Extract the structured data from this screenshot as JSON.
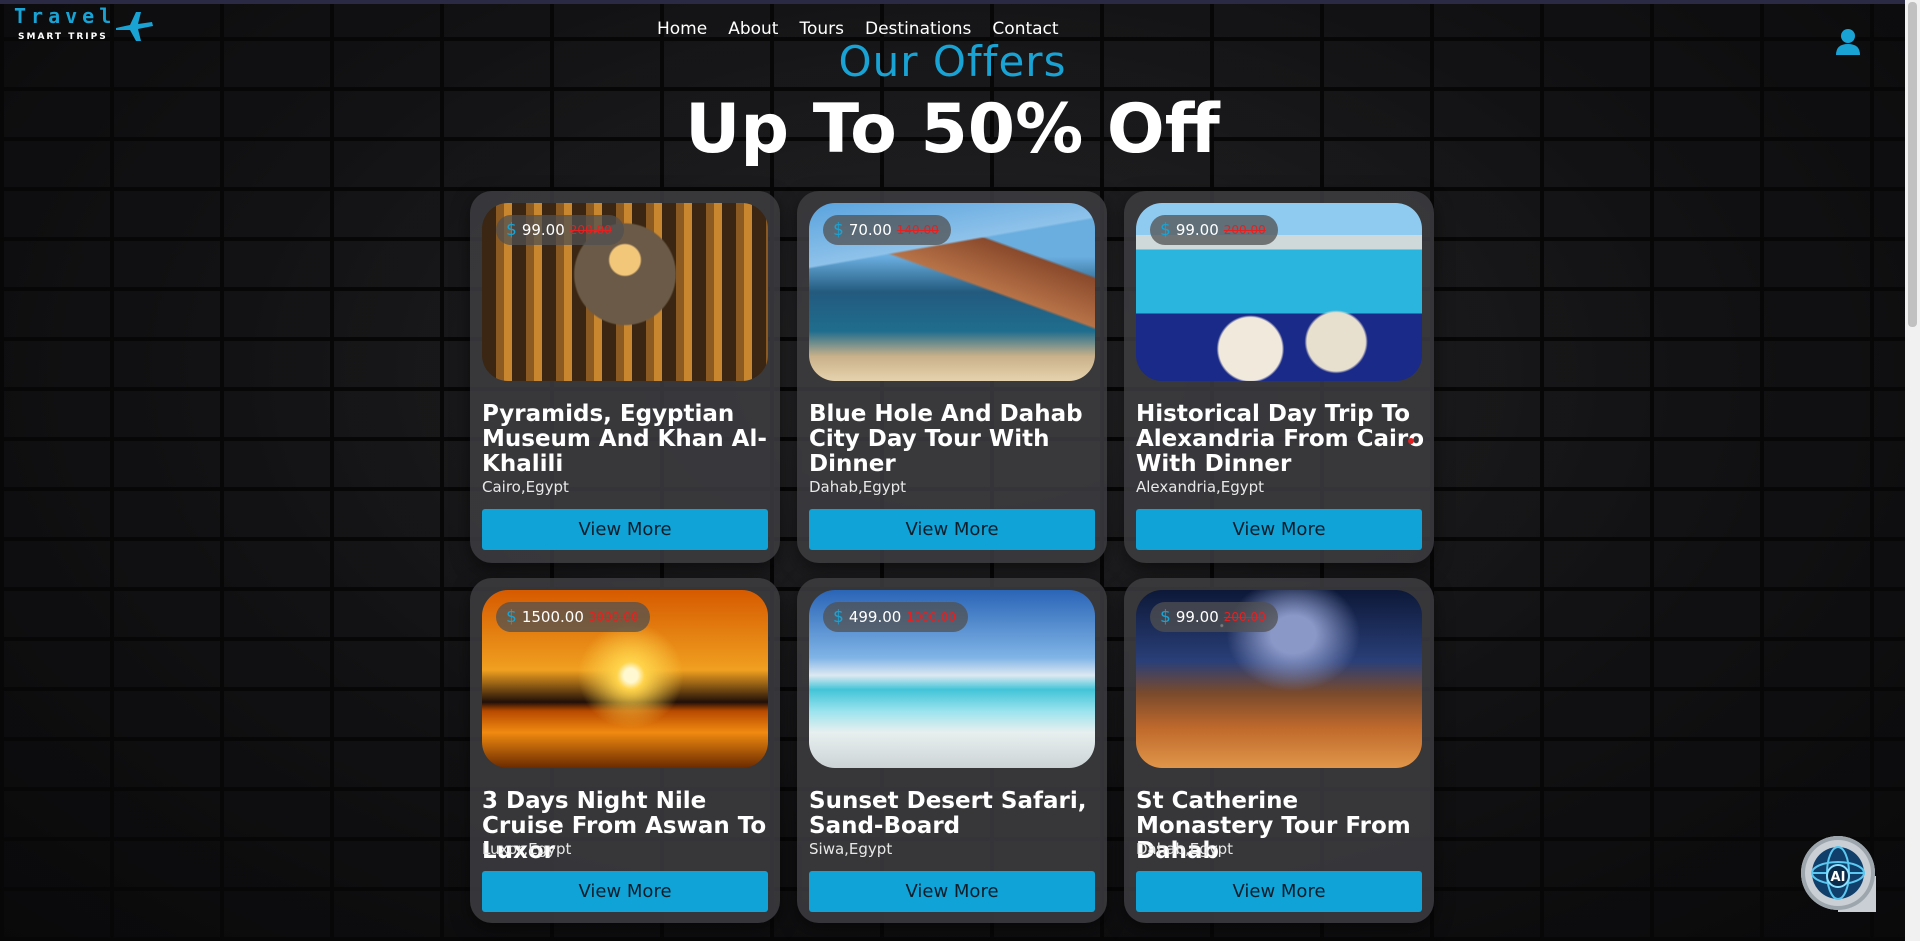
{
  "header": {
    "logo_word": "Travel",
    "logo_sub": "SMART TRIPS",
    "nav": [
      "Home",
      "About",
      "Tours",
      "Destinations",
      "Contact"
    ]
  },
  "section": {
    "subtitle": "Our Offers",
    "title": "Up To 50% Off"
  },
  "offers": [
    {
      "price": "99.00",
      "old_price": "200.00",
      "title": "Pyramids, Egyptian Museum And Khan Al-Khalili",
      "location": "Cairo,Egypt",
      "button": "View More"
    },
    {
      "price": "70.00",
      "old_price": "140.00",
      "title": "Blue Hole And Dahab City Day Tour With Dinner",
      "location": "Dahab,Egypt",
      "button": "View More"
    },
    {
      "price": "99.00",
      "old_price": "200.00",
      "title": "Historical Day Trip To Alexandria From Cairo With Dinner",
      "location": "Alexandria,Egypt",
      "button": "View More"
    },
    {
      "price": "1500.00",
      "old_price": "3000.00",
      "title": "3 Days Night Nile Cruise From Aswan To Luxor",
      "location": "Luxor,Egypt",
      "button": "View More"
    },
    {
      "price": "499.00",
      "old_price": "1000.00",
      "title": "Sunset Desert Safari, Sand-Board",
      "location": "Siwa,Egypt",
      "button": "View More"
    },
    {
      "price": "99.00",
      "old_price": "200.00",
      "title": "St Catherine Monastery Tour From Dahab",
      "location": "Dahab,Egypt",
      "button": "View More"
    }
  ],
  "currency_symbol": "$",
  "ai_label": "AI",
  "colors": {
    "accent": "#19a3d4",
    "button": "#10a3d8",
    "old_price": "#e62020"
  },
  "icons": [
    "plane-icon",
    "user-icon",
    "dollar-icon",
    "ai-globe-icon"
  ]
}
